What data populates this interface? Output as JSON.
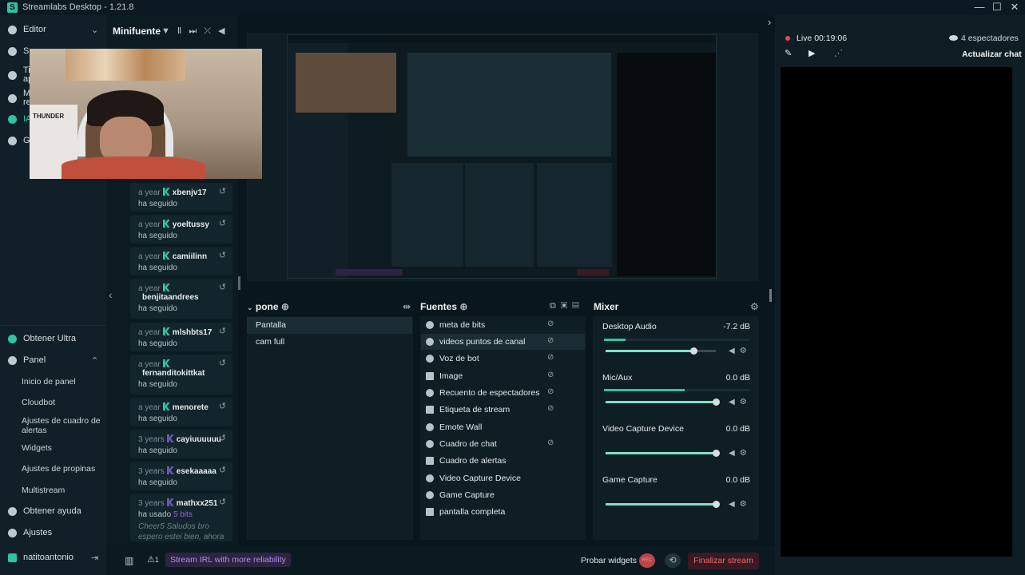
{
  "window": {
    "title": "Streamlabs Desktop - 1.21.8",
    "logo": "S",
    "min": "—",
    "max": "☐",
    "close": "✕"
  },
  "nav": {
    "editor": "Editor",
    "suscripciones_partial": "Su",
    "tienda_partial_1": "Ti",
    "tienda_partial_2": "ap",
    "marketing_partial_1": "M",
    "marketing_partial_2": "re",
    "ia_partial": "IA",
    "grabacion_partial": "Gr",
    "ultra": "Obtener Ultra",
    "panel": "Panel",
    "panel_items": [
      "Inicio de panel",
      "Cloudbot",
      "Ajustes de cuadro de alertas",
      "Widgets",
      "Ajustes de propinas",
      "Multistream"
    ],
    "help": "Obtener ayuda",
    "settings": "Ajustes",
    "user": "natitoantonio"
  },
  "minifeed": {
    "title": "Minifuente",
    "events": [
      {
        "time": "a year",
        "user": "xbenjv17",
        "action": "ha seguido"
      },
      {
        "time": "a year",
        "user": "yoeltussy",
        "action": "ha seguido"
      },
      {
        "time": "a year",
        "user": "camiilinn",
        "action": "ha seguido"
      },
      {
        "time": "a year",
        "user": "benjitaandrees",
        "action": "ha seguido"
      },
      {
        "time": "a year",
        "user": "mlshbts17",
        "action": "ha seguido"
      },
      {
        "time": "a year",
        "user": "fernanditokittkat",
        "action": "ha seguido"
      },
      {
        "time": "a year",
        "user": "menorete",
        "action": "ha seguido"
      },
      {
        "time": "3 years",
        "user": "cayiuuuuuu",
        "action": "ha seguido"
      },
      {
        "time": "3 years",
        "user": "esekaaaaa",
        "action": "ha seguido"
      },
      {
        "time": "3 years",
        "user": "mathxx251",
        "action": "ha usado",
        "bits": "5 bits",
        "msg": "Cheer5 Saludos bro espero estei bien, ahora"
      }
    ]
  },
  "webcam": {
    "chair_text": "THUNDER"
  },
  "scenes": {
    "title": "pone",
    "items": [
      "Pantalla",
      "cam full"
    ]
  },
  "sources": {
    "title": "Fuentes",
    "items": [
      {
        "label": "meta de bits",
        "vis": "⊘"
      },
      {
        "label": "videos puntos de canal",
        "vis": "⊘"
      },
      {
        "label": "Voz de bot",
        "vis": "⊘"
      },
      {
        "label": "Image",
        "vis": "⊘"
      },
      {
        "label": "Recuento de espectadores",
        "vis": "⊘"
      },
      {
        "label": "Etiqueta de stream",
        "vis": "⊘"
      },
      {
        "label": "Emote Wall",
        "vis": ""
      },
      {
        "label": "Cuadro de chat",
        "vis": "⊘"
      },
      {
        "label": "Cuadro de alertas",
        "vis": ""
      },
      {
        "label": "Video Capture Device",
        "vis": ""
      },
      {
        "label": "Game Capture",
        "vis": ""
      },
      {
        "label": "pantalla completa",
        "vis": ""
      }
    ]
  },
  "mixer": {
    "title": "Mixer",
    "channels": [
      {
        "name": "Desktop Audio",
        "db": "-7.2 dB",
        "meter": 0.15,
        "volume": 0.8
      },
      {
        "name": "Mic/Aux",
        "db": "0.0 dB",
        "meter": 0.55,
        "volume": 1.0
      },
      {
        "name": "Video Capture Device",
        "db": "0.0 dB",
        "meter": 0.0,
        "volume": 1.0
      },
      {
        "name": "Game Capture",
        "db": "0.0 dB",
        "meter": 0.0,
        "volume": 1.0
      }
    ]
  },
  "footer": {
    "irl": "Stream IRL with more reliability",
    "alert_count": "1",
    "probar": "Probar widgets",
    "rec": "REC",
    "end": "Finalizar stream"
  },
  "chat": {
    "live": "Live",
    "time": "00:19:06",
    "viewers": "4 espectadores",
    "update": "Actualizar chat"
  },
  "colors": {
    "accent": "#31c3a2",
    "live": "#e54b4b",
    "bits": "#9a62d8",
    "end": "#f0676b"
  }
}
